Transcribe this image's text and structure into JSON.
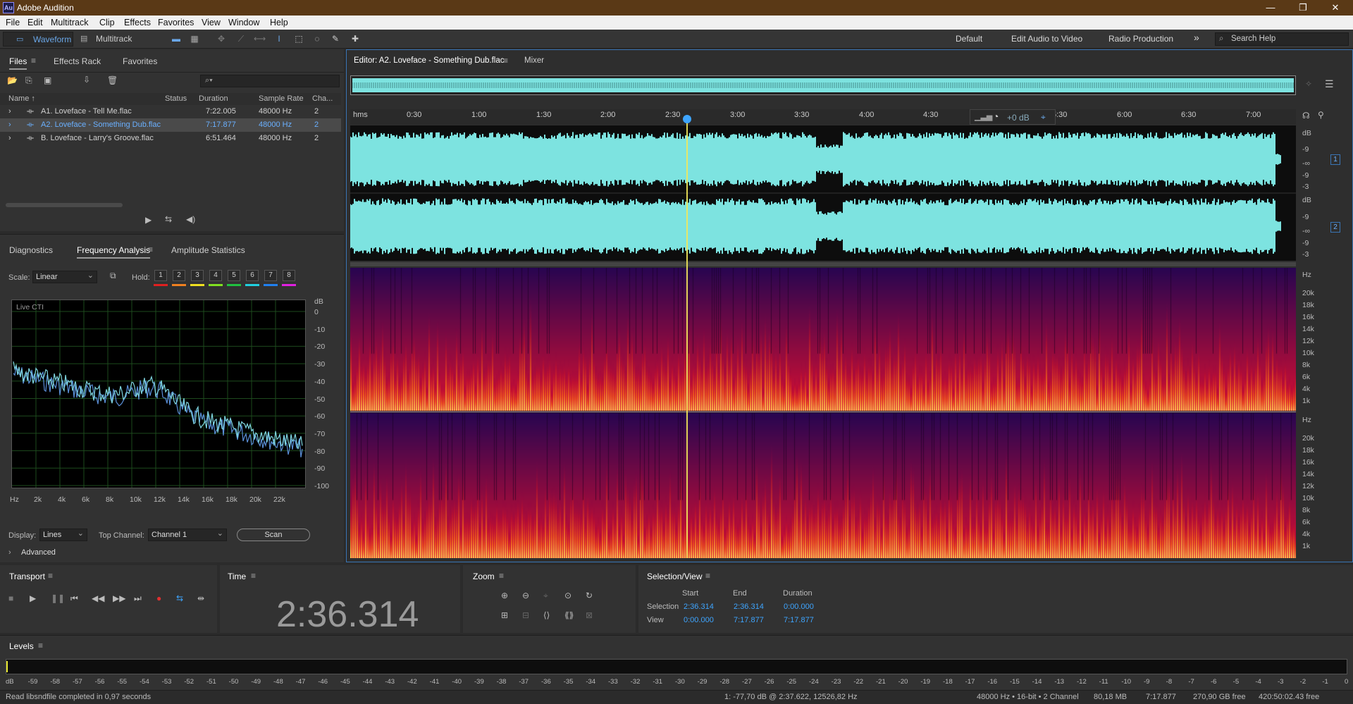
{
  "app": {
    "title": "Adobe Audition",
    "icon_text": "Au"
  },
  "window_controls": {
    "minimize": "—",
    "restore": "❐",
    "close": "✕"
  },
  "menu": [
    "File",
    "Edit",
    "Multitrack",
    "Clip",
    "Effects",
    "Favorites",
    "View",
    "Window",
    "Help"
  ],
  "toolbar": {
    "waveform_label": "Waveform",
    "multitrack_label": "Multitrack",
    "workspaces": [
      "Default",
      "Edit Audio to Video",
      "Radio Production"
    ],
    "more": "»",
    "search_placeholder": "Search Help"
  },
  "files_panel": {
    "tabs": [
      "Files",
      "Effects Rack",
      "Favorites"
    ],
    "menu_icon": "≡",
    "search_icon": "⌕▾",
    "columns": [
      "Name ↑",
      "Status",
      "Duration",
      "Sample Rate",
      "Cha..."
    ],
    "rows": [
      {
        "name": "A1. Loveface - Tell Me.flac",
        "duration": "7:22.005",
        "sample_rate": "48000 Hz",
        "channels": "2",
        "selected": false
      },
      {
        "name": "A2. Loveface - Something Dub.flac",
        "duration": "7:17.877",
        "sample_rate": "48000 Hz",
        "channels": "2",
        "selected": true
      },
      {
        "name": "B. Loveface - Larry's Groove.flac",
        "duration": "6:51.464",
        "sample_rate": "48000 Hz",
        "channels": "2",
        "selected": false
      }
    ]
  },
  "freq_panel": {
    "tabs": [
      "Diagnostics",
      "Frequency Analysis",
      "Amplitude Statistics"
    ],
    "scale_label": "Scale:",
    "scale_value": "Linear",
    "hold_label": "Hold:",
    "hold_buttons": [
      "1",
      "2",
      "3",
      "4",
      "5",
      "6",
      "7",
      "8"
    ],
    "hold_colors": [
      "#e02020",
      "#f08020",
      "#f0e020",
      "#80e020",
      "#20c040",
      "#20d0e0",
      "#2080f0",
      "#e020e0"
    ],
    "graph_label": "Live CTI",
    "db_unit": "dB",
    "db_ticks": [
      "0",
      "-10",
      "-20",
      "-30",
      "-40",
      "-50",
      "-60",
      "-70",
      "-80",
      "-90",
      "-100"
    ],
    "hz_ticks": [
      "Hz",
      "2k",
      "4k",
      "6k",
      "8k",
      "10k",
      "12k",
      "14k",
      "16k",
      "18k",
      "20k",
      "22k"
    ],
    "display_label": "Display:",
    "display_value": "Lines",
    "top_channel_label": "Top Channel:",
    "top_channel_value": "Channel 1",
    "scan_button": "Scan",
    "advanced_label": "Advanced"
  },
  "editor": {
    "tab_label": "Editor: A2. Loveface - Something Dub.flac",
    "mixer_label": "Mixer",
    "ruler_unit": "hms",
    "ruler_ticks": [
      "0:30",
      "1:00",
      "1:30",
      "2:00",
      "2:30",
      "3:00",
      "3:30",
      "4:00",
      "4:30",
      "5:30",
      "6:00",
      "6:30",
      "7:00"
    ],
    "gain_label": "+0 dB",
    "channel_badges": [
      "1",
      "2"
    ],
    "wave_db_labels": [
      "dB",
      "-9",
      "-∞",
      "-9",
      "-3"
    ],
    "hz_unit": "Hz",
    "spec_labels": [
      "20k",
      "18k",
      "16k",
      "14k",
      "12k",
      "10k",
      "8k",
      "6k",
      "4k",
      "1k"
    ],
    "playhead_fraction": 0.358,
    "wave_color": "#7de3e0",
    "playhead_color": "#f2e85a"
  },
  "transport": {
    "title": "Transport"
  },
  "time_panel": {
    "title": "Time",
    "value": "2:36.314"
  },
  "zoom_panel": {
    "title": "Zoom"
  },
  "selview": {
    "title": "Selection/View",
    "cols": [
      "Start",
      "End",
      "Duration"
    ],
    "selection_label": "Selection",
    "view_label": "View",
    "selection": [
      "2:36.314",
      "2:36.314",
      "0:00.000"
    ],
    "view": [
      "0:00.000",
      "7:17.877",
      "7:17.877"
    ]
  },
  "levels": {
    "title": "Levels",
    "scale": [
      "dB",
      "-59",
      "-58",
      "-57",
      "-56",
      "-55",
      "-54",
      "-53",
      "-52",
      "-51",
      "-50",
      "-49",
      "-48",
      "-47",
      "-46",
      "-45",
      "-44",
      "-43",
      "-42",
      "-41",
      "-40",
      "-39",
      "-38",
      "-37",
      "-36",
      "-35",
      "-34",
      "-33",
      "-32",
      "-31",
      "-30",
      "-29",
      "-28",
      "-27",
      "-26",
      "-25",
      "-24",
      "-23",
      "-22",
      "-21",
      "-20",
      "-19",
      "-18",
      "-17",
      "-16",
      "-15",
      "-14",
      "-13",
      "-12",
      "-11",
      "-10",
      "-9",
      "-8",
      "-7",
      "-6",
      "-5",
      "-4",
      "-3",
      "-2",
      "-1",
      "0"
    ]
  },
  "status": {
    "message": "Read libsndfile completed in 0,97 seconds",
    "cursor_info": "1: -77,70 dB @ 2:37.622, 12526,82 Hz",
    "format": "48000 Hz • 16-bit • 2 Channel",
    "size": "80,18 MB",
    "duration": "7:17.877",
    "free": "270,90 GB free",
    "free_time": "420:50:02.43 free"
  }
}
